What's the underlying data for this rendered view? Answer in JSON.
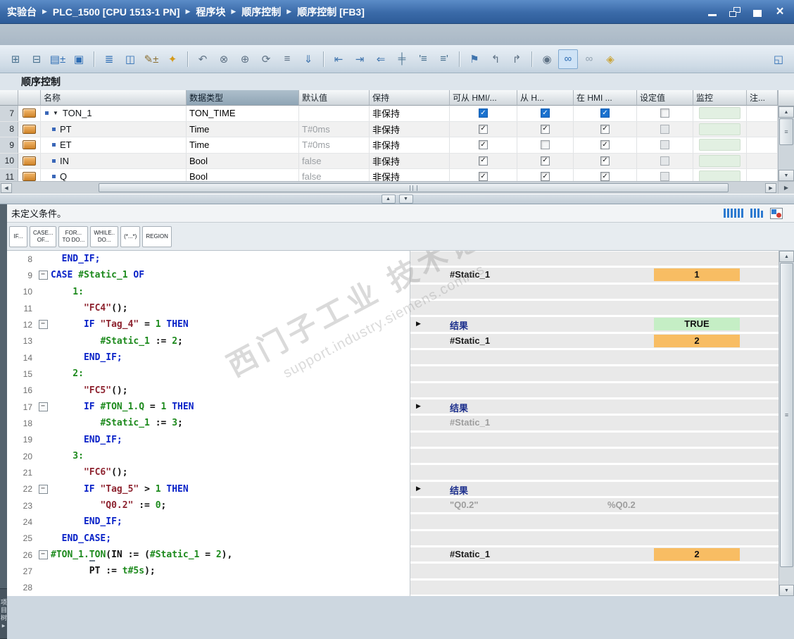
{
  "title_bar": {
    "breadcrumbs": [
      "实验台",
      "PLC_1500 [CPU 1513-1 PN]",
      "程序块",
      "顺序控制",
      "顺序控制 [FB3]"
    ],
    "window_buttons": [
      "minimize",
      "restore-down",
      "maximize",
      "close"
    ]
  },
  "toolbar": {
    "icons": [
      {
        "name": "insert-network-icon",
        "glyph": "⊞",
        "color": "#49718f"
      },
      {
        "name": "insert-row-icon",
        "glyph": "⊟",
        "color": "#49718f"
      },
      {
        "name": "add-parameter-icon",
        "glyph": "▤±",
        "color": "#2e6db4"
      },
      {
        "name": "block-interface-icon",
        "glyph": "▣",
        "color": "#2e6db4",
        "sep_after": true
      },
      {
        "name": "absolute-operands-icon",
        "glyph": "≣",
        "color": "#2e6db4"
      },
      {
        "name": "split-window-icon",
        "glyph": "◫",
        "color": "#2e6db4"
      },
      {
        "name": "edit-declaration-icon",
        "glyph": "✎±",
        "color": "#8a6d2f"
      },
      {
        "name": "snippets-favorites-icon",
        "glyph": "✦",
        "color": "#d49a1a",
        "sep_after": true
      },
      {
        "name": "go-to-definition-icon",
        "glyph": "↶",
        "color": "#5f7285"
      },
      {
        "name": "cross-references-icon",
        "glyph": "⊗",
        "color": "#5f7285"
      },
      {
        "name": "call-structure-icon",
        "glyph": "⊕",
        "color": "#5f7285"
      },
      {
        "name": "update-block-calls-icon",
        "glyph": "⟳",
        "color": "#5f7285"
      },
      {
        "name": "show-hidden-lines-icon",
        "glyph": "≡",
        "color": "#5f7285"
      },
      {
        "name": "expand-all-icon",
        "glyph": "⇓",
        "color": "#3f74ad",
        "sep_after": true
      },
      {
        "name": "outdent-icon",
        "glyph": "⇤",
        "color": "#3f74ad"
      },
      {
        "name": "indent-icon",
        "glyph": "⇥",
        "color": "#3f74ad"
      },
      {
        "name": "shift-left-icon",
        "glyph": "⇐",
        "color": "#3f74ad"
      },
      {
        "name": "auto-format-icon",
        "glyph": "╪",
        "color": "#49718f"
      },
      {
        "name": "comment-lines-icon",
        "glyph": "'≡",
        "color": "#49718f"
      },
      {
        "name": "uncomment-lines-icon",
        "glyph": "≡'",
        "color": "#49718f",
        "sep_after": true
      },
      {
        "name": "bookmark-icon",
        "glyph": "⚑",
        "color": "#3f74ad"
      },
      {
        "name": "previous-position-icon",
        "glyph": "↰",
        "color": "#5f7285"
      },
      {
        "name": "next-position-icon",
        "glyph": "↱",
        "color": "#5f7285",
        "sep_after": true
      },
      {
        "name": "breakpoints-icon",
        "glyph": "◉",
        "color": "#5f7285"
      },
      {
        "name": "monitoring-on-icon",
        "glyph": "∞",
        "color": "#2e6db4",
        "pressed": true
      },
      {
        "name": "monitoring-snapshot-icon",
        "glyph": "∞",
        "color": "#93a3b1"
      },
      {
        "name": "know-how-protection-icon",
        "glyph": "◈",
        "color": "#caa53a"
      }
    ],
    "right_icon": {
      "name": "maximize-editor-icon",
      "glyph": "◱",
      "color": "#2e6db4"
    }
  },
  "section_title": "顺序控制",
  "var_table": {
    "columns": [
      {
        "label": ""
      },
      {
        "label": ""
      },
      {
        "label": "名称"
      },
      {
        "label": "数据类型",
        "active": true
      },
      {
        "label": "默认值"
      },
      {
        "label": "保持"
      },
      {
        "label": "可从 HMI/..."
      },
      {
        "label": "从 H..."
      },
      {
        "label": "在 HMI ..."
      },
      {
        "label": "设定值"
      },
      {
        "label": "监控"
      },
      {
        "label": "注..."
      }
    ],
    "rows": [
      {
        "num": "7",
        "level": 0,
        "expand": true,
        "name": "TON_1",
        "type": "TON_TIME",
        "default": "",
        "retain": "非保持",
        "checks": [
          "blue",
          "blue",
          "blue"
        ],
        "setpoint": "off-white"
      },
      {
        "num": "8",
        "level": 1,
        "name": "PT",
        "type": "Time",
        "default": "T#0ms",
        "retain": "非保持",
        "checks": [
          "std",
          "std",
          "std"
        ],
        "setpoint": "off-gray"
      },
      {
        "num": "9",
        "level": 1,
        "name": "ET",
        "type": "Time",
        "default": "T#0ms",
        "retain": "非保持",
        "checks": [
          "std",
          "off",
          "std"
        ],
        "setpoint": "off-gray"
      },
      {
        "num": "10",
        "level": 1,
        "name": "IN",
        "type": "Bool",
        "default": "false",
        "retain": "非保持",
        "checks": [
          "std",
          "std",
          "std"
        ],
        "setpoint": "off-gray"
      },
      {
        "num": "11",
        "level": 1,
        "name": "Q",
        "type": "Bool",
        "default": "false",
        "retain": "非保持",
        "checks": [
          "std",
          "std",
          "std"
        ],
        "setpoint": "off-gray"
      }
    ]
  },
  "status_bar": {
    "text": "未定义条件。",
    "icons": [
      {
        "name": "operand-columns-icon",
        "type": "bars",
        "heights": [
          13,
          13,
          13,
          13,
          13,
          13
        ]
      },
      {
        "name": "operand-columns-narrow-icon",
        "type": "bars",
        "heights": [
          13,
          13,
          13,
          10
        ]
      },
      {
        "name": "breakpoint-view-icon",
        "type": "redblue"
      }
    ]
  },
  "snippet_tabs": [
    {
      "l1": "IF...",
      "l2": ""
    },
    {
      "l1": "CASE...",
      "l2": "OF..."
    },
    {
      "l1": "FOR...",
      "l2": "TO DO..."
    },
    {
      "l1": "WHILE..",
      "l2": "DO..."
    },
    {
      "l1": "(*...*)",
      "l2": ""
    },
    {
      "l1": "REGION",
      "l2": ""
    }
  ],
  "code": {
    "lines": [
      {
        "n": "8",
        "ind": 2,
        "segs": [
          [
            "END_IF;",
            "kw"
          ]
        ]
      },
      {
        "n": "9",
        "ind": 0,
        "fold": true,
        "segs": [
          [
            "CASE",
            "kw"
          ],
          [
            " ",
            ""
          ],
          [
            "#Static_1",
            "lv"
          ],
          [
            " ",
            ""
          ],
          [
            "OF",
            "kw"
          ]
        ]
      },
      {
        "n": "10",
        "ind": 4,
        "segs": [
          [
            "1:",
            "num"
          ]
        ]
      },
      {
        "n": "11",
        "ind": 6,
        "segs": [
          [
            "\"FC4\"",
            "gv"
          ],
          [
            "();",
            "op"
          ]
        ]
      },
      {
        "n": "12",
        "ind": 6,
        "fold": true,
        "segs": [
          [
            "IF",
            "kw"
          ],
          [
            " ",
            ""
          ],
          [
            "\"Tag_4\"",
            "gv"
          ],
          [
            " ",
            ""
          ],
          [
            "=",
            "op"
          ],
          [
            " ",
            ""
          ],
          [
            "1",
            "num"
          ],
          [
            " ",
            ""
          ],
          [
            "THEN",
            "kw"
          ]
        ]
      },
      {
        "n": "13",
        "ind": 9,
        "segs": [
          [
            "#Static_1",
            "lv"
          ],
          [
            " ",
            ""
          ],
          [
            ":=",
            "op"
          ],
          [
            " ",
            ""
          ],
          [
            "2",
            "num"
          ],
          [
            ";",
            "op"
          ]
        ]
      },
      {
        "n": "14",
        "ind": 6,
        "segs": [
          [
            "END_IF;",
            "kw"
          ]
        ]
      },
      {
        "n": "15",
        "ind": 4,
        "segs": [
          [
            "2:",
            "num"
          ]
        ]
      },
      {
        "n": "16",
        "ind": 6,
        "segs": [
          [
            "\"FC5\"",
            "gv"
          ],
          [
            "();",
            "op"
          ]
        ]
      },
      {
        "n": "17",
        "ind": 6,
        "fold": true,
        "segs": [
          [
            "IF",
            "kw"
          ],
          [
            " ",
            ""
          ],
          [
            "#TON_1.Q",
            "lv"
          ],
          [
            " ",
            ""
          ],
          [
            "=",
            "op"
          ],
          [
            " ",
            ""
          ],
          [
            "1",
            "num"
          ],
          [
            " ",
            ""
          ],
          [
            "THEN",
            "kw"
          ]
        ]
      },
      {
        "n": "18",
        "ind": 9,
        "segs": [
          [
            "#Static_1",
            "lv"
          ],
          [
            " ",
            ""
          ],
          [
            ":=",
            "op"
          ],
          [
            " ",
            ""
          ],
          [
            "3",
            "num"
          ],
          [
            ";",
            "op"
          ]
        ]
      },
      {
        "n": "19",
        "ind": 6,
        "segs": [
          [
            "END_IF;",
            "kw"
          ]
        ]
      },
      {
        "n": "20",
        "ind": 4,
        "segs": [
          [
            "3:",
            "num"
          ]
        ]
      },
      {
        "n": "21",
        "ind": 6,
        "segs": [
          [
            "\"FC6\"",
            "gv"
          ],
          [
            "();",
            "op"
          ]
        ]
      },
      {
        "n": "22",
        "ind": 6,
        "fold": true,
        "segs": [
          [
            "IF",
            "kw"
          ],
          [
            " ",
            ""
          ],
          [
            "\"Tag_5\"",
            "gv"
          ],
          [
            " ",
            ""
          ],
          [
            ">",
            "op"
          ],
          [
            " ",
            ""
          ],
          [
            "1",
            "num"
          ],
          [
            " ",
            ""
          ],
          [
            "THEN",
            "kw"
          ]
        ]
      },
      {
        "n": "23",
        "ind": 9,
        "segs": [
          [
            "\"Q0.2\"",
            "gv"
          ],
          [
            " ",
            ""
          ],
          [
            ":=",
            "op"
          ],
          [
            " ",
            ""
          ],
          [
            "0",
            "num"
          ],
          [
            ";",
            "op"
          ]
        ]
      },
      {
        "n": "24",
        "ind": 6,
        "segs": [
          [
            "END_IF;",
            "kw"
          ]
        ]
      },
      {
        "n": "25",
        "ind": 2,
        "segs": [
          [
            "END_CASE;",
            "kw"
          ]
        ]
      },
      {
        "n": "26",
        "ind": 0,
        "fold": true,
        "segs": [
          [
            "#TON_1.",
            "lv"
          ],
          [
            "T",
            "lvu"
          ],
          [
            "ON",
            "lv"
          ],
          [
            "(",
            "op"
          ],
          [
            "IN",
            "param"
          ],
          [
            " ",
            ""
          ],
          [
            ":=",
            "op"
          ],
          [
            " (",
            "op"
          ],
          [
            "#Static_1",
            "lv"
          ],
          [
            " ",
            ""
          ],
          [
            "=",
            "op"
          ],
          [
            " ",
            ""
          ],
          [
            "2",
            "num"
          ],
          [
            "),",
            "op"
          ]
        ]
      },
      {
        "n": "27",
        "ind": 7,
        "segs": [
          [
            "PT",
            "param"
          ],
          [
            " ",
            ""
          ],
          [
            ":=",
            "op"
          ],
          [
            " ",
            ""
          ],
          [
            "t#5s",
            "num"
          ],
          [
            ");",
            "op"
          ]
        ]
      },
      {
        "n": "28",
        "ind": 0,
        "segs": []
      }
    ],
    "monitors": {
      "9": {
        "name": "#Static_1",
        "value": "1",
        "vstyle": "orange"
      },
      "12": {
        "marker": true,
        "name": "结果",
        "nstyle": "result",
        "value": "TRUE",
        "vstyle": "green"
      },
      "13": {
        "name": "#Static_1",
        "value": "2",
        "vstyle": "orange"
      },
      "17": {
        "marker": true,
        "name": "结果",
        "nstyle": "result"
      },
      "18": {
        "name": "#Static_1",
        "nstyle": "gray"
      },
      "22": {
        "marker": true,
        "name": "结果",
        "nstyle": "result"
      },
      "23": {
        "name": "\"Q0.2\"",
        "nstyle": "gray",
        "addr": "%Q0.2"
      },
      "26": {
        "name": "#Static_1",
        "value": "2",
        "vstyle": "orange"
      }
    }
  },
  "watermark": {
    "line1": "西门子工业 技术论坛",
    "line2": "support.industry.siemens.com/cs"
  },
  "side_tab": {
    "label": "项目树"
  },
  "colors": {
    "titlebar_blue": "#3a6aa8",
    "checkbox_blue": "#1a72cf",
    "monitor_orange": "#f8bd63",
    "monitor_green": "#c5eec5",
    "keyword_blue": "#0a23c8",
    "local_var_green": "#1d8a1d",
    "global_var_maroon": "#8e2430"
  }
}
